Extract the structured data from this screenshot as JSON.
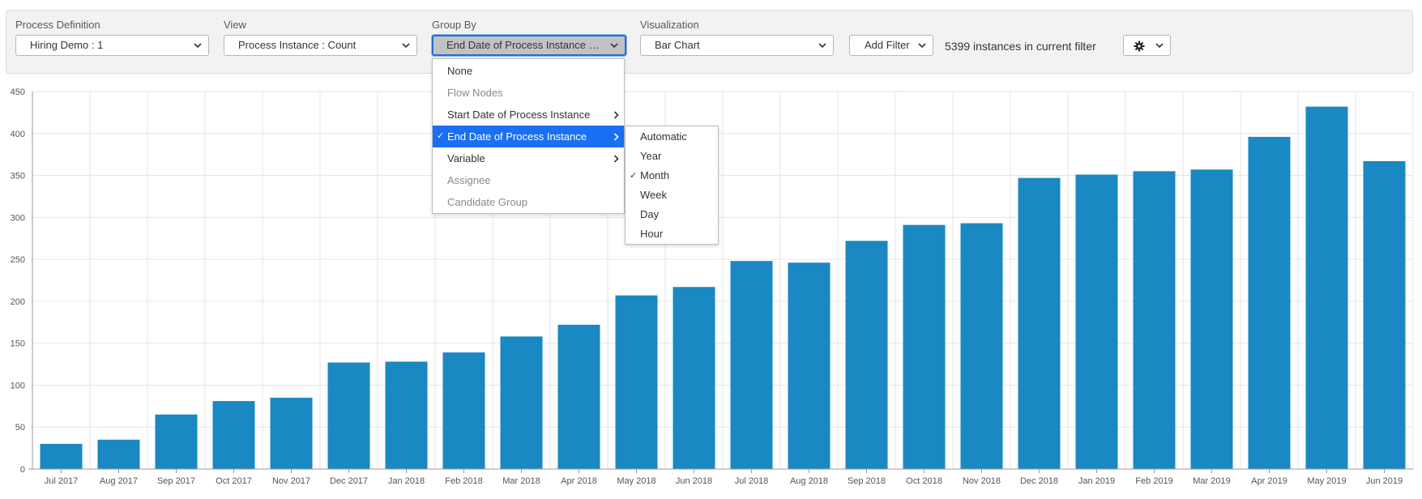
{
  "controls": {
    "process_definition": {
      "label": "Process Definition",
      "value": "Hiring Demo : 1"
    },
    "view": {
      "label": "View",
      "value": "Process Instance : Count"
    },
    "group_by": {
      "label": "Group By",
      "value": "End Date of Process Instance :..."
    },
    "visualization": {
      "label": "Visualization",
      "value": "Bar Chart"
    },
    "add_filter_label": "Add Filter",
    "instances_text": "5399 instances in current filter",
    "settings_icon": "gear-icon"
  },
  "groupby_menu": {
    "items": [
      {
        "label": "None",
        "disabled": false,
        "selected": false,
        "has_submenu": false
      },
      {
        "label": "Flow Nodes",
        "disabled": true,
        "selected": false,
        "has_submenu": false
      },
      {
        "label": "Start Date of Process Instance",
        "disabled": false,
        "selected": false,
        "has_submenu": true
      },
      {
        "label": "End Date of Process Instance",
        "disabled": false,
        "selected": true,
        "has_submenu": true
      },
      {
        "label": "Variable",
        "disabled": false,
        "selected": false,
        "has_submenu": true
      },
      {
        "label": "Assignee",
        "disabled": true,
        "selected": false,
        "has_submenu": false
      },
      {
        "label": "Candidate Group",
        "disabled": true,
        "selected": false,
        "has_submenu": false
      }
    ]
  },
  "date_submenu": {
    "items": [
      {
        "label": "Automatic",
        "checked": false
      },
      {
        "label": "Year",
        "checked": false
      },
      {
        "label": "Month",
        "checked": true
      },
      {
        "label": "Week",
        "checked": false
      },
      {
        "label": "Day",
        "checked": false
      },
      {
        "label": "Hour",
        "checked": false
      }
    ]
  },
  "colors": {
    "bar": "#1a88c2",
    "selected_menu_bg": "#1a6ff2",
    "grid": "#e6e6e6"
  },
  "chart_data": {
    "type": "bar",
    "title": "",
    "xlabel": "",
    "ylabel": "",
    "ylim": [
      0,
      450
    ],
    "yticks": [
      0,
      50,
      100,
      150,
      200,
      250,
      300,
      350,
      400,
      450
    ],
    "grid": true,
    "categories": [
      "Jul 2017",
      "Aug 2017",
      "Sep 2017",
      "Oct 2017",
      "Nov 2017",
      "Dec 2017",
      "Jan 2018",
      "Feb 2018",
      "Mar 2018",
      "Apr 2018",
      "May 2018",
      "Jun 2018",
      "Jul 2018",
      "Aug 2018",
      "Sep 2018",
      "Oct 2018",
      "Nov 2018",
      "Dec 2018",
      "Jan 2019",
      "Feb 2019",
      "Mar 2019",
      "Apr 2019",
      "May 2019",
      "Jun 2019"
    ],
    "values": [
      30,
      35,
      65,
      81,
      85,
      127,
      128,
      139,
      158,
      172,
      207,
      217,
      248,
      246,
      272,
      291,
      293,
      347,
      351,
      355,
      357,
      396,
      432,
      367
    ]
  }
}
